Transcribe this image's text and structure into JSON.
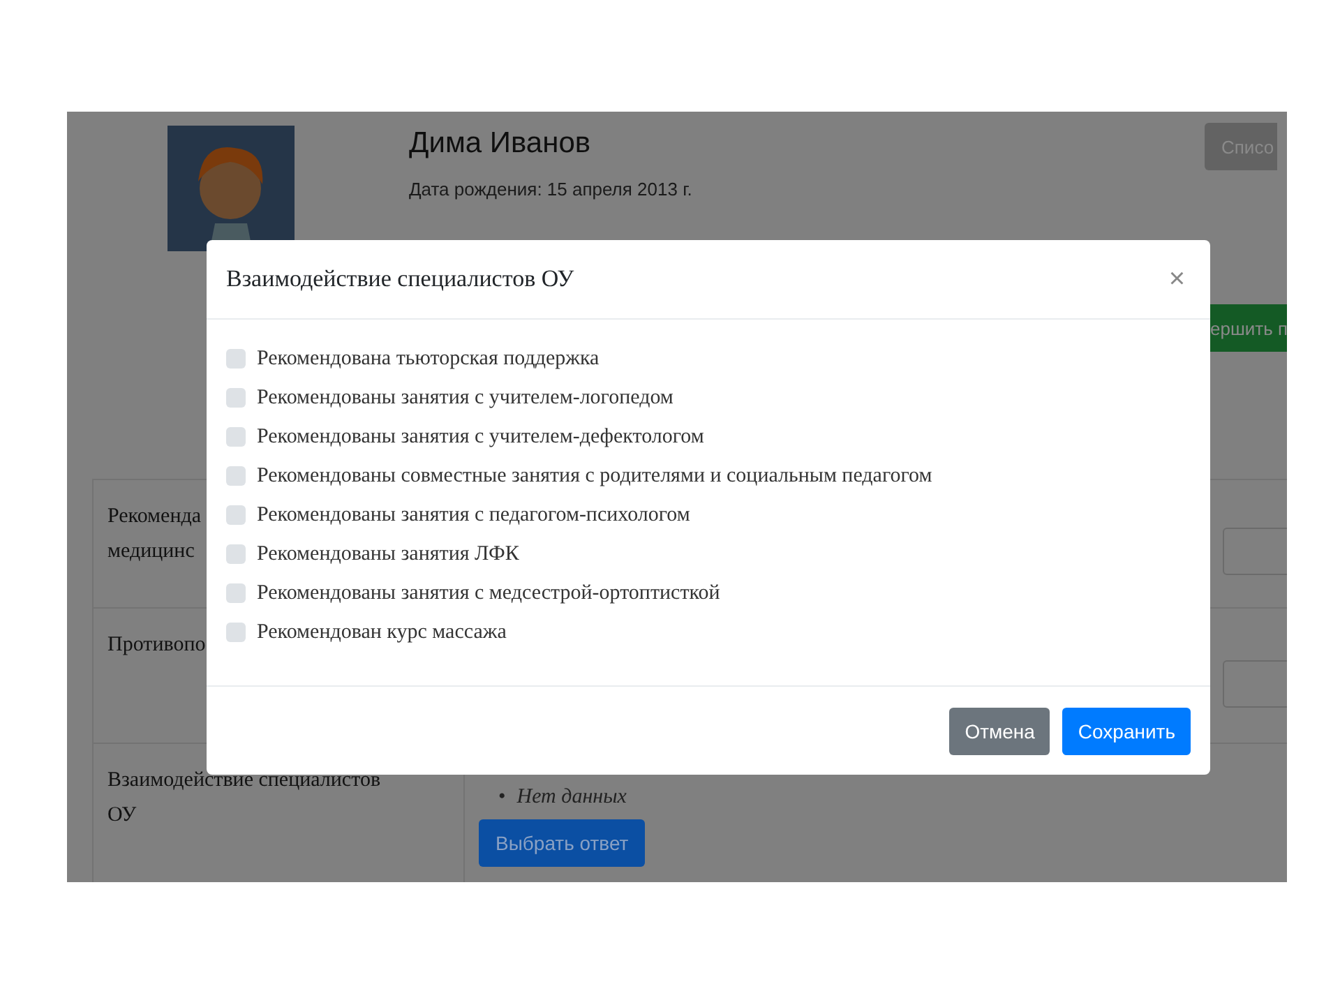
{
  "profile": {
    "name": "Дима Иванов",
    "birth_date": "Дата рождения: 15 апреля 2013 г."
  },
  "header_buttons": [
    {
      "label": "Списо",
      "kind": "secondary"
    },
    {
      "label": "ершить п",
      "kind": "success"
    }
  ],
  "table": {
    "rows": [
      {
        "label_lines": [
          "Рекоменда",
          "медицинс"
        ],
        "kind": "input"
      },
      {
        "label_lines": [
          "Противопо"
        ],
        "kind": "input"
      },
      {
        "label_lines": [
          "Взаимодействие специалистов",
          "ОУ"
        ],
        "kind": "answers",
        "items": [
          {
            "bullet": "•",
            "text": "Нет данных"
          }
        ],
        "button": "Выбрать ответ"
      }
    ]
  },
  "modal": {
    "title": "Взаимодействие специалистов ОУ",
    "close": "×",
    "options": [
      {
        "label": "Рекомендована тьюторская поддержка",
        "checked": false
      },
      {
        "label": "Рекомендованы занятия с учителем-логопедом",
        "checked": false
      },
      {
        "label": "Рекомендованы занятия с учителем-дефектологом",
        "checked": false
      },
      {
        "label": "Рекомендованы совместные занятия с родителями и социальным педагогом",
        "checked": false
      },
      {
        "label": "Рекомендованы занятия с педагогом-психологом",
        "checked": false
      },
      {
        "label": "Рекомендованы занятия ЛФК",
        "checked": false
      },
      {
        "label": "Рекомендованы занятия с медсестрой-ортоптисткой",
        "checked": false
      },
      {
        "label": "Рекомендован курс массажа",
        "checked": false
      }
    ],
    "buttons": [
      {
        "label": "Отмена",
        "kind": "secondary"
      },
      {
        "label": "Сохранить",
        "kind": "primary"
      }
    ]
  }
}
